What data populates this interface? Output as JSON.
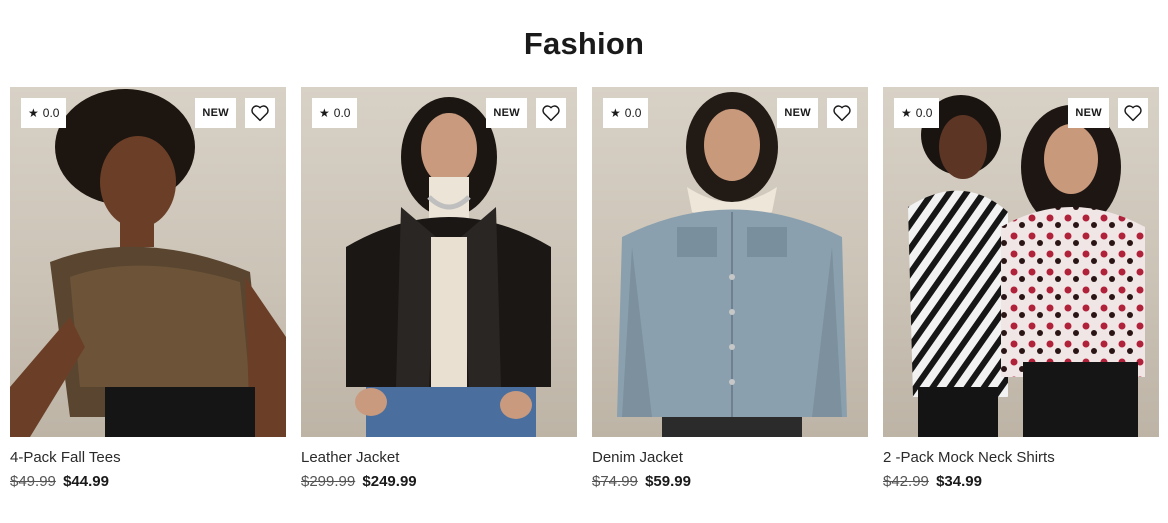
{
  "section": {
    "title": "Fashion"
  },
  "products": [
    {
      "name": "4-Pack Fall Tees",
      "rating": "0.0",
      "badge": "NEW",
      "old_price": "$49.99",
      "price": "$44.99"
    },
    {
      "name": "Leather Jacket",
      "rating": "0.0",
      "badge": "NEW",
      "old_price": "$299.99",
      "price": "$249.99"
    },
    {
      "name": "Denim Jacket",
      "rating": "0.0",
      "badge": "NEW",
      "old_price": "$74.99",
      "price": "$59.99"
    },
    {
      "name": "2 -Pack Mock Neck Shirts",
      "rating": "0.0",
      "badge": "NEW",
      "old_price": "$42.99",
      "price": "$34.99"
    }
  ],
  "icons": {
    "rating": "star-icon",
    "favorite": "heart-icon"
  },
  "colors": {
    "text": "#1a1a1a",
    "photo_bg": "#cbc3b6",
    "badge_bg": "#ffffff"
  }
}
